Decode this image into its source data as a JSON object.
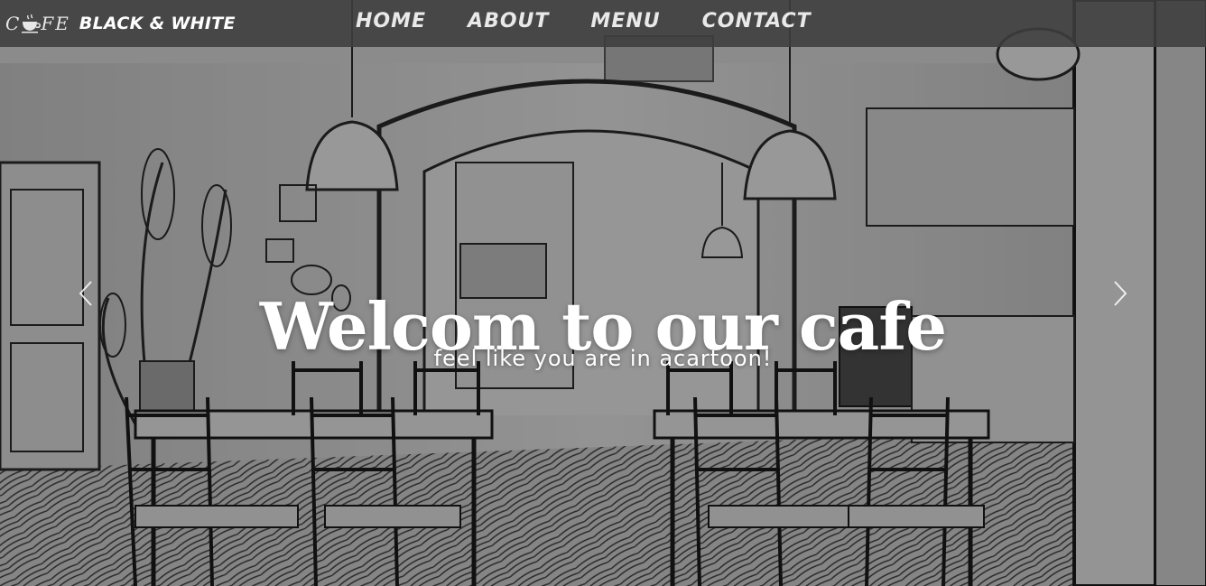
{
  "brand": {
    "logo_prefix": "C☕FE",
    "logo_name": "BLACK & WHITE"
  },
  "nav": {
    "items": [
      {
        "label": "HOME"
      },
      {
        "label": "ABOUT"
      },
      {
        "label": "MENU"
      },
      {
        "label": "CONTACT"
      }
    ]
  },
  "hero": {
    "title": "Welcom to our cafe",
    "subtitle": "feel like you are in acartoon!"
  },
  "icons": {
    "logo": "coffee-cup-icon",
    "prev": "chevron-left-icon",
    "next": "chevron-right-icon"
  },
  "colors": {
    "navbar": "#3e3e3e",
    "text": "#ffffff"
  }
}
